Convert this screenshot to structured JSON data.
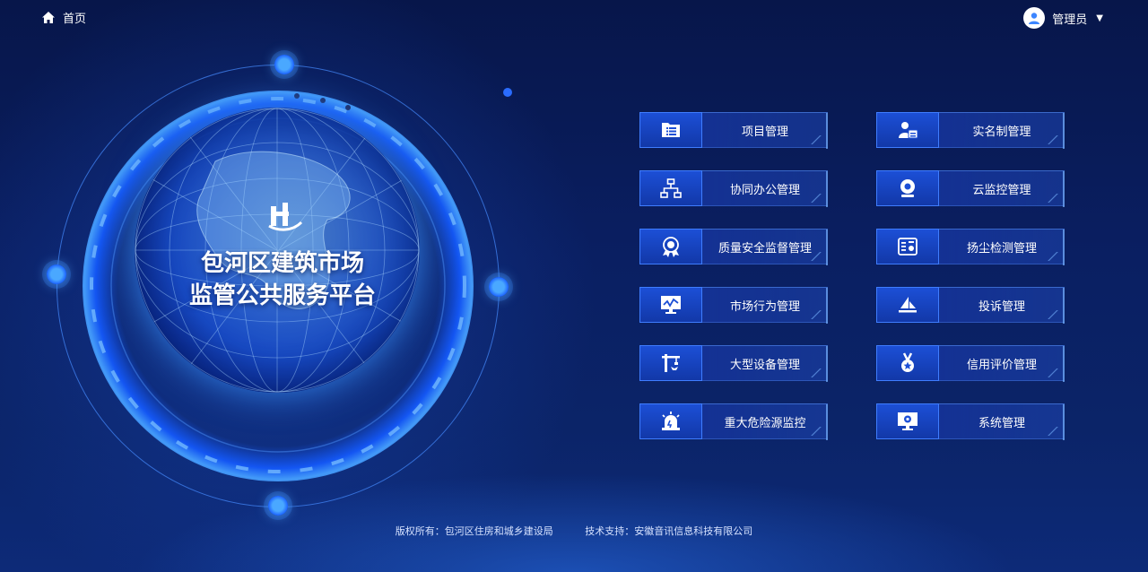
{
  "topbar": {
    "home_label": "首页",
    "user_name": "管理员"
  },
  "platform": {
    "title_line1": "包河区建筑市场",
    "title_line2": "监管公共服务平台"
  },
  "menu": {
    "items": [
      {
        "label": "项目管理",
        "icon": "folder-list-icon"
      },
      {
        "label": "实名制管理",
        "icon": "id-card-icon"
      },
      {
        "label": "协同办公管理",
        "icon": "org-chart-icon"
      },
      {
        "label": "云监控管理",
        "icon": "webcam-icon"
      },
      {
        "label": "质量安全监督管理",
        "icon": "badge-icon"
      },
      {
        "label": "扬尘检测管理",
        "icon": "dust-monitor-icon"
      },
      {
        "label": "市场行为管理",
        "icon": "monitor-chart-icon"
      },
      {
        "label": "投诉管理",
        "icon": "send-icon"
      },
      {
        "label": "大型设备管理",
        "icon": "crane-icon"
      },
      {
        "label": "信用评价管理",
        "icon": "medal-icon"
      },
      {
        "label": "重大危险源监控",
        "icon": "alarm-light-icon"
      },
      {
        "label": "系统管理",
        "icon": "gear-screen-icon"
      }
    ]
  },
  "footer": {
    "copyright": "版权所有：包河区住房和城乡建设局",
    "support": "技术支持：安徽音讯信息科技有限公司"
  },
  "colors": {
    "accent": "#3f7dff",
    "background": "#0a1f62"
  }
}
